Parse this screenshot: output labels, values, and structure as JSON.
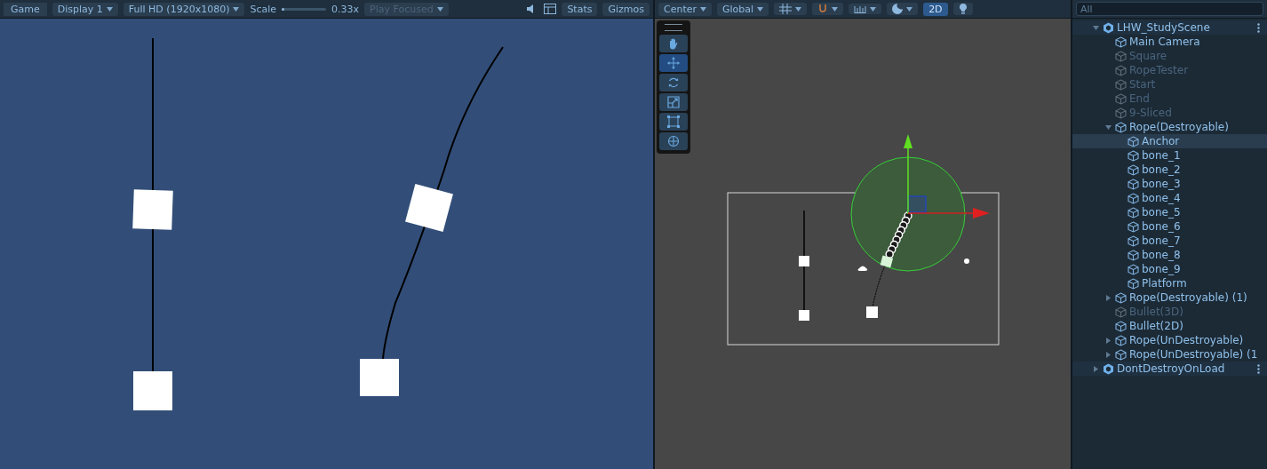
{
  "game_view": {
    "toolbar": {
      "tab": {
        "label": "Game",
        "selected": true
      },
      "display": "Display 1",
      "resolution": "Full HD (1920x1080)",
      "scale_label": "Scale",
      "scale": {
        "level": 0.05
      },
      "scale_value": "0.33x",
      "play_mode": "Play Focused",
      "stats": "Stats",
      "gizmos": "Gizmos"
    }
  },
  "scene_view": {
    "toolbar": {
      "pivot": "Center",
      "space": "Global",
      "mode_2d": {
        "label": "2D",
        "on": true
      }
    },
    "tools": [
      {
        "kind": "hand",
        "selected": false
      },
      {
        "kind": "move",
        "selected": true
      },
      {
        "kind": "rotate",
        "selected": false
      },
      {
        "kind": "scale",
        "selected": false
      },
      {
        "kind": "rect",
        "selected": false
      },
      {
        "kind": "transform",
        "selected": false
      }
    ]
  },
  "hierarchy": {
    "search": {
      "placeholder": "All"
    },
    "scenes": [
      {
        "name": "LHW_StudyScene",
        "expanded": true,
        "children": [
          {
            "name": "Main Camera",
            "active": true,
            "selected": false
          },
          {
            "name": "Square",
            "active": false,
            "selected": false
          },
          {
            "name": "RopeTester",
            "active": false,
            "selected": false
          },
          {
            "name": "Start",
            "active": false,
            "selected": false
          },
          {
            "name": "End",
            "active": false,
            "selected": false
          },
          {
            "name": "9-Sliced",
            "active": false,
            "selected": false
          },
          {
            "name": "Rope(Destroyable)",
            "active": true,
            "selected": false,
            "expanded": true,
            "children": [
              {
                "name": "Anchor",
                "active": true,
                "selected": true
              },
              {
                "name": "bone_1",
                "active": true,
                "selected": false
              },
              {
                "name": "bone_2",
                "active": true,
                "selected": false
              },
              {
                "name": "bone_3",
                "active": true,
                "selected": false
              },
              {
                "name": "bone_4",
                "active": true,
                "selected": false
              },
              {
                "name": "bone_5",
                "active": true,
                "selected": false
              },
              {
                "name": "bone_6",
                "active": true,
                "selected": false
              },
              {
                "name": "bone_7",
                "active": true,
                "selected": false
              },
              {
                "name": "bone_8",
                "active": true,
                "selected": false
              },
              {
                "name": "bone_9",
                "active": true,
                "selected": false
              },
              {
                "name": "Platform",
                "active": true,
                "selected": false
              }
            ]
          },
          {
            "name": "Rope(Destroyable) (1)",
            "active": true,
            "selected": false,
            "expanded": false
          },
          {
            "name": "Bullet(3D)",
            "active": false,
            "selected": false
          },
          {
            "name": "Bullet(2D)",
            "active": true,
            "selected": false
          },
          {
            "name": "Rope(UnDestroyable)",
            "active": true,
            "selected": false,
            "expanded": false
          },
          {
            "name": "Rope(UnDestroyable) (1",
            "active": true,
            "selected": false,
            "expanded": false
          }
        ]
      },
      {
        "name": "DontDestroyOnLoad",
        "expanded": false
      }
    ]
  }
}
